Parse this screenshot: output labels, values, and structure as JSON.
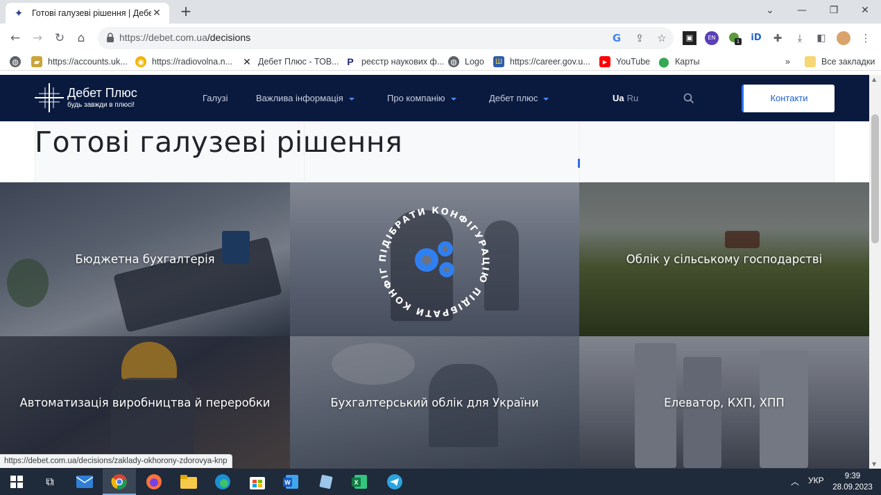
{
  "browser": {
    "tab_title": "Готові галузеві рішення | Дебет",
    "url_host": "https://debet.com.ua",
    "url_path": "/decisions",
    "bookmarks": [
      {
        "label": "https://accounts.uk..."
      },
      {
        "label": "https://radiovolna.n..."
      },
      {
        "label": "Дебет Плюс - ТОВ..."
      },
      {
        "label": "реєстр наукових ф..."
      },
      {
        "label": "Logo"
      },
      {
        "label": "https://career.gov.u..."
      },
      {
        "label": "YouTube"
      },
      {
        "label": "Карты"
      }
    ],
    "bookmarks_more": "»",
    "all_bookmarks": "Все закладки",
    "ext_en_label": "EN",
    "ext_badge": "1",
    "ext_id_label": "iD",
    "status_url": "https://debet.com.ua/decisions/zaklady-okhorony-zdorovya-knp"
  },
  "site": {
    "logo_name": "Дебет Плюс",
    "logo_tagline": "будь завжди в плюсі!",
    "menu": [
      {
        "label": "Галузі"
      },
      {
        "label": "Важлива інформація"
      },
      {
        "label": "Про компанію"
      },
      {
        "label": "Дебет плюс"
      }
    ],
    "lang_active": "Ua",
    "lang_other": "Ru",
    "contact_button": "Контакти",
    "page_title": "Готові галузеві рішення",
    "badge_text": "ПІДІБРАТИ КОНФІГУРАЦІЮ ПІДІБРАТИ КОНФІГУРАЦІЮ",
    "tiles": [
      {
        "label": "Бюджетна бухгалтерія"
      },
      {
        "label": ""
      },
      {
        "label": "Облік у сільському господарстві"
      },
      {
        "label": "Автоматизація виробництва й переробки"
      },
      {
        "label": "Бухгалтерський облік для України"
      },
      {
        "label": "Елеватор, КХП, ХПП"
      }
    ]
  },
  "taskbar": {
    "lang": "УКР",
    "time": "9:39",
    "date": "28.09.2023"
  },
  "colors": {
    "header_bg": "#0a1a3f",
    "accent": "#2b6fe8"
  }
}
